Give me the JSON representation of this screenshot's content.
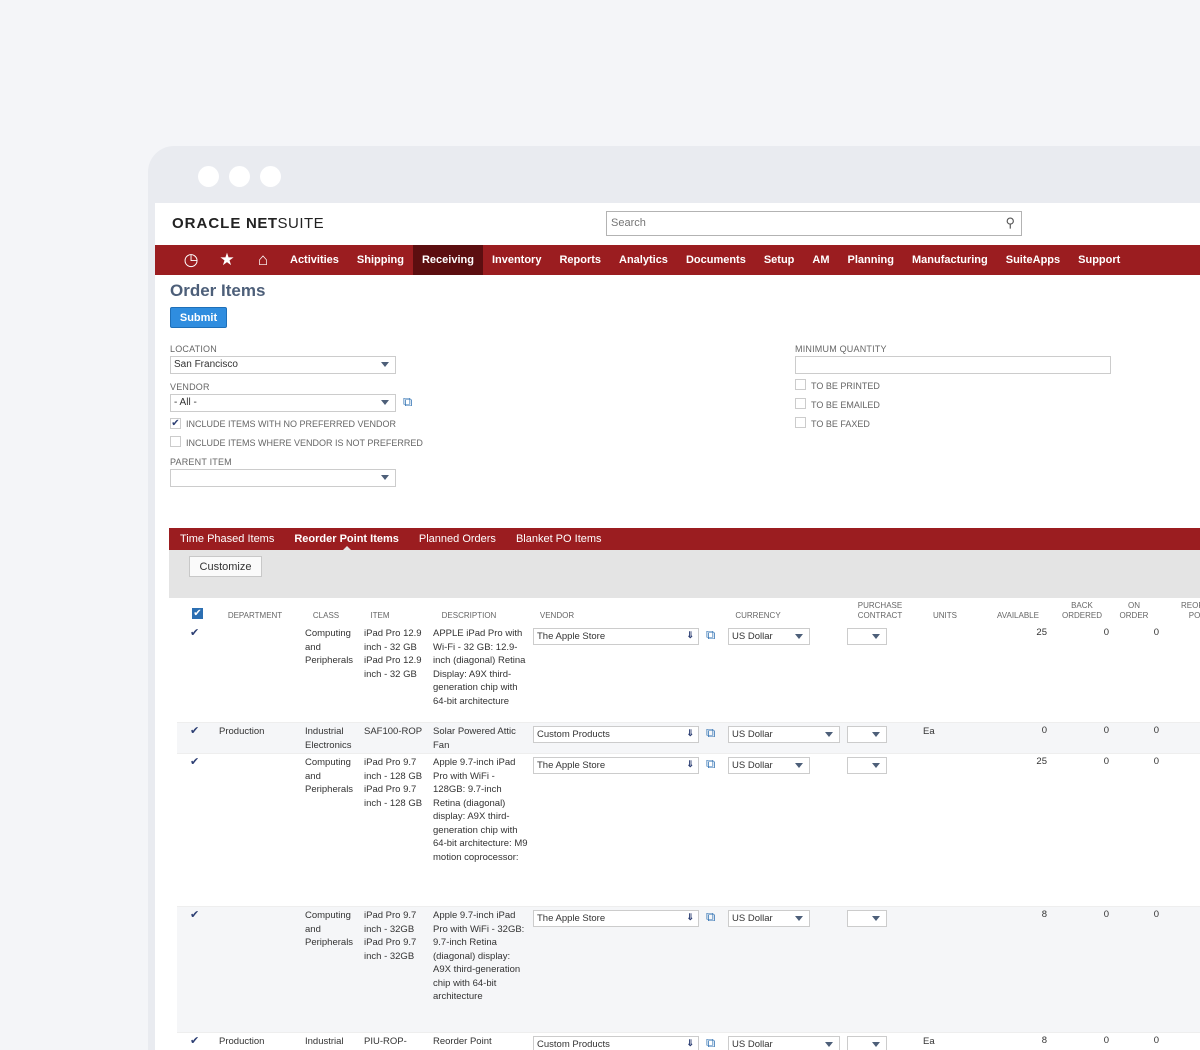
{
  "app": {
    "logo_part1": "ORACLE",
    "logo_part2": "NET",
    "logo_part3": "SUITE",
    "search_placeholder": "Search"
  },
  "nav": {
    "icons": [
      "recent-records-icon",
      "favorites-star-icon",
      "home-icon"
    ],
    "items": [
      "Activities",
      "Shipping",
      "Receiving",
      "Inventory",
      "Reports",
      "Analytics",
      "Documents",
      "Setup",
      "AM",
      "Planning",
      "Manufacturing",
      "SuiteApps",
      "Support"
    ],
    "active": "Receiving"
  },
  "page": {
    "title": "Order Items",
    "submit_label": "Submit"
  },
  "form": {
    "location_label": "Location",
    "location_value": "San Francisco",
    "vendor_label": "Vendor",
    "vendor_value": "- All -",
    "include_no_pref_label": "Include items with no preferred vendor",
    "include_no_pref_checked": true,
    "include_not_pref_label": "Include items where vendor is not preferred",
    "include_not_pref_checked": false,
    "parent_item_label": "Parent Item",
    "parent_item_value": "",
    "min_qty_label": "Minimum Quantity",
    "min_qty_value": "",
    "to_be_printed_label": "To be printed",
    "to_be_emailed_label": "To be emailed",
    "to_be_faxed_label": "To be faxed"
  },
  "tabs": [
    "Time Phased Items",
    "Reorder Point Items",
    "Planned Orders",
    "Blanket PO Items"
  ],
  "active_tab": "Reorder Point Items",
  "grid": {
    "customize_label": "Customize",
    "columns": {
      "department": "Department",
      "class": "Class",
      "item": "Item",
      "description": "Description",
      "vendor": "Vendor",
      "currency": "Currency",
      "purchase_contract": "Purchase Contract",
      "units": "Units",
      "available": "Available",
      "back_ordered": "Back Ordered",
      "on_order": "On Order",
      "reorder_point": "Reorder Point"
    },
    "rows": [
      {
        "department": "",
        "class": "Computing and Peripherals",
        "item": "iPad Pro 12.9 inch - 32 GB iPad Pro 12.9 inch - 32 GB",
        "description": "APPLE iPad Pro with Wi-Fi - 32 GB: 12.9-inch (diagonal) Retina Display: A9X third-generation chip with 64-bit architecture",
        "vendor": "The Apple Store",
        "currency": "US Dollar",
        "units": "",
        "available": "25",
        "back_ordered": "0",
        "on_order": "0"
      },
      {
        "department": "Production",
        "class": "Industrial Electronics",
        "item": "SAF100-ROP",
        "description": "Solar Powered Attic Fan",
        "vendor": "Custom Products",
        "currency": "US Dollar",
        "units": "Ea",
        "available": "0",
        "back_ordered": "0",
        "on_order": "0"
      },
      {
        "department": "",
        "class": "Computing and Peripherals",
        "item": "iPad Pro 9.7 inch - 128 GB iPad Pro 9.7 inch - 128 GB",
        "description": "Apple 9.7-inch iPad Pro with WiFi - 128GB: 9.7-inch Retina (diagonal) display: A9X third-generation chip with 64-bit architecture: M9 motion coprocessor:",
        "vendor": "The Apple Store",
        "currency": "US Dollar",
        "units": "",
        "available": "25",
        "back_ordered": "0",
        "on_order": "0"
      },
      {
        "department": "",
        "class": "Computing and Peripherals",
        "item": "iPad Pro 9.7 inch - 32GB iPad Pro 9.7 inch - 32GB",
        "description": "Apple 9.7-inch iPad Pro with WiFi - 32GB: 9.7-inch Retina (diagonal) display: A9X third-generation chip with 64-bit architecture",
        "vendor": "The Apple Store",
        "currency": "US Dollar",
        "units": "",
        "available": "8",
        "back_ordered": "0",
        "on_order": "0"
      },
      {
        "department": "Production",
        "class": "Industrial",
        "item": "PIU-ROP-",
        "description": "Reorder Point",
        "vendor": "Custom Products",
        "currency": "US Dollar",
        "units": "Ea",
        "available": "8",
        "back_ordered": "0",
        "on_order": "0"
      }
    ]
  },
  "colors": {
    "nav_bg": "#9b1d20",
    "nav_active": "#5c0e10",
    "title": "#4d5f79",
    "submit": "#2f8ddf"
  }
}
